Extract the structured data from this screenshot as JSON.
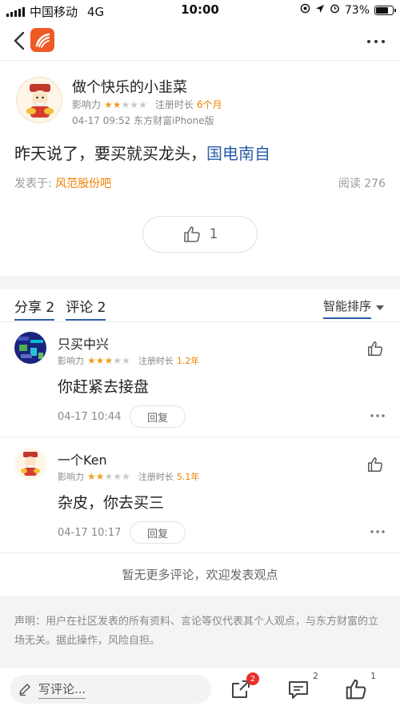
{
  "status_bar": {
    "carrier": "中国移动",
    "network": "4G",
    "time": "10:00",
    "battery": "73%",
    "battery_level": 0.73
  },
  "post": {
    "author": "做个快乐的小韭菜",
    "influence_label": "影响力",
    "influence_stars": 2,
    "reg_label": "注册时长",
    "reg_value": "6个月",
    "time_device": "04-17 09:52 东方财富iPhone版",
    "body_text": "昨天说了，要买就买龙头，",
    "body_link": "国电南自",
    "source_label": "发表于:",
    "source_bar": "风范股份吧",
    "read_label": "阅读 276",
    "like_count": "1"
  },
  "tabs": {
    "share": "分享 2",
    "comment": "评论 2",
    "sort": "智能排序"
  },
  "comments": [
    {
      "name": "只买中兴",
      "influence_label": "影响力",
      "stars": 3,
      "reg_label": "注册时长",
      "reg_value": "1.2年",
      "text": "你赶紧去接盘",
      "time": "04-17 10:44",
      "reply": "回复"
    },
    {
      "name": "一个Ken",
      "influence_label": "影响力",
      "stars": 2,
      "reg_label": "注册时长",
      "reg_value": "5.1年",
      "text": "杂皮，你去买三",
      "time": "04-17 10:17",
      "reply": "回复"
    }
  ],
  "no_more_text": "暂无更多评论，欢迎发表观点",
  "disclaimer": "声明：用户在社区发表的所有资料、言论等仅代表其个人观点，与东方财富的立场无关。据此操作，风险自担。",
  "bottom_bar": {
    "write_placeholder": "写评论...",
    "share_badge": "2",
    "comment_badge": "2",
    "like_badge": "1"
  },
  "colors": {
    "accent_orange": "#f08000",
    "link_blue": "#2a5ca8",
    "brand_logo": "#ee5a24",
    "badge_red": "#e8302a"
  }
}
